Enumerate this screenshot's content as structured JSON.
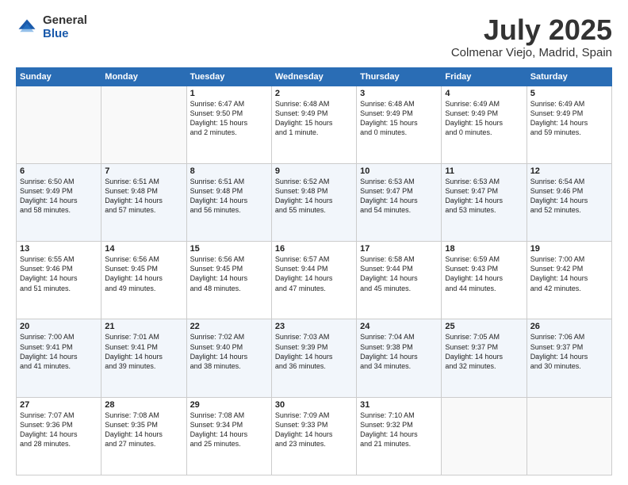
{
  "header": {
    "logo": {
      "general": "General",
      "blue": "Blue"
    },
    "month": "July 2025",
    "location": "Colmenar Viejo, Madrid, Spain"
  },
  "weekdays": [
    "Sunday",
    "Monday",
    "Tuesday",
    "Wednesday",
    "Thursday",
    "Friday",
    "Saturday"
  ],
  "weeks": [
    [
      {
        "day": "",
        "info": ""
      },
      {
        "day": "",
        "info": ""
      },
      {
        "day": "1",
        "info": "Sunrise: 6:47 AM\nSunset: 9:50 PM\nDaylight: 15 hours\nand 2 minutes."
      },
      {
        "day": "2",
        "info": "Sunrise: 6:48 AM\nSunset: 9:49 PM\nDaylight: 15 hours\nand 1 minute."
      },
      {
        "day": "3",
        "info": "Sunrise: 6:48 AM\nSunset: 9:49 PM\nDaylight: 15 hours\nand 0 minutes."
      },
      {
        "day": "4",
        "info": "Sunrise: 6:49 AM\nSunset: 9:49 PM\nDaylight: 15 hours\nand 0 minutes."
      },
      {
        "day": "5",
        "info": "Sunrise: 6:49 AM\nSunset: 9:49 PM\nDaylight: 14 hours\nand 59 minutes."
      }
    ],
    [
      {
        "day": "6",
        "info": "Sunrise: 6:50 AM\nSunset: 9:49 PM\nDaylight: 14 hours\nand 58 minutes."
      },
      {
        "day": "7",
        "info": "Sunrise: 6:51 AM\nSunset: 9:48 PM\nDaylight: 14 hours\nand 57 minutes."
      },
      {
        "day": "8",
        "info": "Sunrise: 6:51 AM\nSunset: 9:48 PM\nDaylight: 14 hours\nand 56 minutes."
      },
      {
        "day": "9",
        "info": "Sunrise: 6:52 AM\nSunset: 9:48 PM\nDaylight: 14 hours\nand 55 minutes."
      },
      {
        "day": "10",
        "info": "Sunrise: 6:53 AM\nSunset: 9:47 PM\nDaylight: 14 hours\nand 54 minutes."
      },
      {
        "day": "11",
        "info": "Sunrise: 6:53 AM\nSunset: 9:47 PM\nDaylight: 14 hours\nand 53 minutes."
      },
      {
        "day": "12",
        "info": "Sunrise: 6:54 AM\nSunset: 9:46 PM\nDaylight: 14 hours\nand 52 minutes."
      }
    ],
    [
      {
        "day": "13",
        "info": "Sunrise: 6:55 AM\nSunset: 9:46 PM\nDaylight: 14 hours\nand 51 minutes."
      },
      {
        "day": "14",
        "info": "Sunrise: 6:56 AM\nSunset: 9:45 PM\nDaylight: 14 hours\nand 49 minutes."
      },
      {
        "day": "15",
        "info": "Sunrise: 6:56 AM\nSunset: 9:45 PM\nDaylight: 14 hours\nand 48 minutes."
      },
      {
        "day": "16",
        "info": "Sunrise: 6:57 AM\nSunset: 9:44 PM\nDaylight: 14 hours\nand 47 minutes."
      },
      {
        "day": "17",
        "info": "Sunrise: 6:58 AM\nSunset: 9:44 PM\nDaylight: 14 hours\nand 45 minutes."
      },
      {
        "day": "18",
        "info": "Sunrise: 6:59 AM\nSunset: 9:43 PM\nDaylight: 14 hours\nand 44 minutes."
      },
      {
        "day": "19",
        "info": "Sunrise: 7:00 AM\nSunset: 9:42 PM\nDaylight: 14 hours\nand 42 minutes."
      }
    ],
    [
      {
        "day": "20",
        "info": "Sunrise: 7:00 AM\nSunset: 9:41 PM\nDaylight: 14 hours\nand 41 minutes."
      },
      {
        "day": "21",
        "info": "Sunrise: 7:01 AM\nSunset: 9:41 PM\nDaylight: 14 hours\nand 39 minutes."
      },
      {
        "day": "22",
        "info": "Sunrise: 7:02 AM\nSunset: 9:40 PM\nDaylight: 14 hours\nand 38 minutes."
      },
      {
        "day": "23",
        "info": "Sunrise: 7:03 AM\nSunset: 9:39 PM\nDaylight: 14 hours\nand 36 minutes."
      },
      {
        "day": "24",
        "info": "Sunrise: 7:04 AM\nSunset: 9:38 PM\nDaylight: 14 hours\nand 34 minutes."
      },
      {
        "day": "25",
        "info": "Sunrise: 7:05 AM\nSunset: 9:37 PM\nDaylight: 14 hours\nand 32 minutes."
      },
      {
        "day": "26",
        "info": "Sunrise: 7:06 AM\nSunset: 9:37 PM\nDaylight: 14 hours\nand 30 minutes."
      }
    ],
    [
      {
        "day": "27",
        "info": "Sunrise: 7:07 AM\nSunset: 9:36 PM\nDaylight: 14 hours\nand 28 minutes."
      },
      {
        "day": "28",
        "info": "Sunrise: 7:08 AM\nSunset: 9:35 PM\nDaylight: 14 hours\nand 27 minutes."
      },
      {
        "day": "29",
        "info": "Sunrise: 7:08 AM\nSunset: 9:34 PM\nDaylight: 14 hours\nand 25 minutes."
      },
      {
        "day": "30",
        "info": "Sunrise: 7:09 AM\nSunset: 9:33 PM\nDaylight: 14 hours\nand 23 minutes."
      },
      {
        "day": "31",
        "info": "Sunrise: 7:10 AM\nSunset: 9:32 PM\nDaylight: 14 hours\nand 21 minutes."
      },
      {
        "day": "",
        "info": ""
      },
      {
        "day": "",
        "info": ""
      }
    ]
  ]
}
